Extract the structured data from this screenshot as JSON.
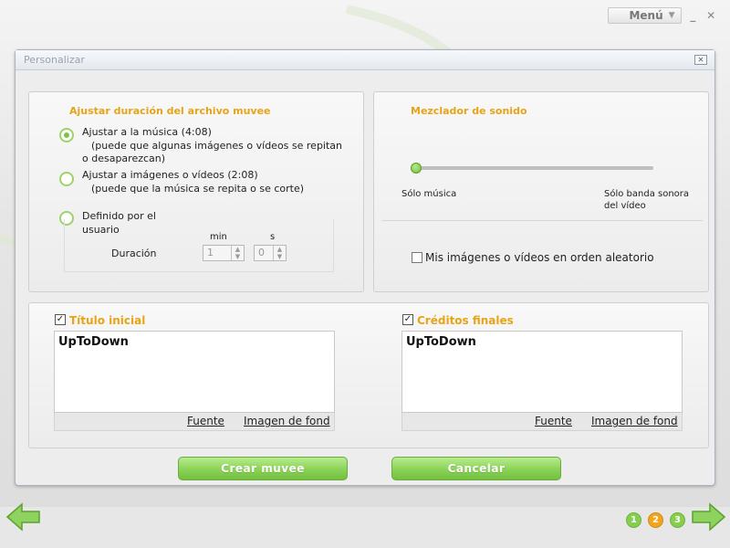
{
  "app": {
    "menu_label": "Menú",
    "colors": {
      "accent_orange": "#e8a316",
      "green": "#7cc447",
      "step_active": "#f2a51c"
    }
  },
  "dialog": {
    "title": "Personalizar",
    "duration_panel": {
      "heading": "Ajustar duración del archivo muvee",
      "options": [
        {
          "label": "Ajustar a la música (4:08)",
          "note": "(puede que algunas imágenes o vídeos se repitan",
          "note2": "o desaparezcan)",
          "selected": true
        },
        {
          "label": "Ajustar a imágenes o vídeos (2:08)",
          "note": "(puede que la música se repita o se corte)",
          "selected": false
        },
        {
          "label": "Definido por el",
          "label2": "usuario",
          "selected": false
        }
      ],
      "duration_label": "Duración",
      "min_label": "min",
      "sec_label": "s",
      "min_value": "1",
      "sec_value": "0"
    },
    "mixer_panel": {
      "heading": "Mezclador de sonido",
      "slider_value": 0,
      "left_label": "Sólo música",
      "right_label_1": "Sólo banda sonora",
      "right_label_2": "del vídeo",
      "shuffle_label": "Mis imágenes o vídeos en orden aleatorio",
      "shuffle_checked": false
    },
    "title_panel": {
      "heading": "Título inicial",
      "checked": true,
      "text": "UpToDown",
      "font_link": "Fuente",
      "bg_link": "Imagen de fond"
    },
    "credits_panel": {
      "heading": "Créditos finales",
      "checked": true,
      "text": "UpToDown",
      "font_link": "Fuente",
      "bg_link": "Imagen de fond"
    },
    "create_button": "Crear muvee",
    "cancel_button": "Cancelar"
  },
  "footer": {
    "steps": [
      "1",
      "2",
      "3"
    ],
    "active_step": 2
  }
}
